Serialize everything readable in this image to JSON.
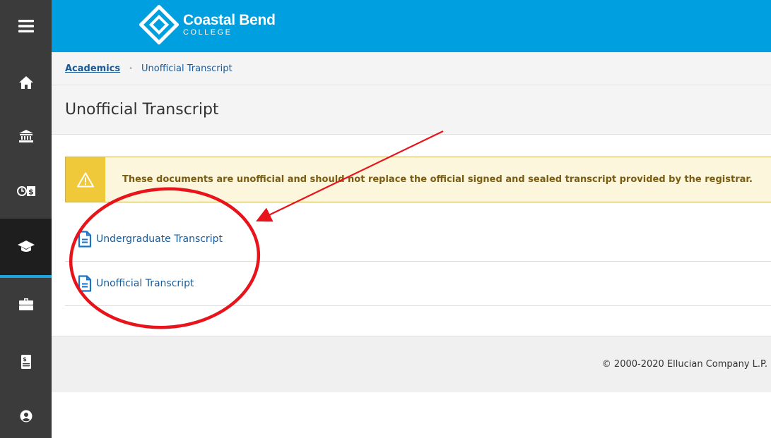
{
  "header": {
    "logo_name": "Coastal Bend",
    "logo_sub": "COLLEGE",
    "color": "#009fe0"
  },
  "rail": {
    "items": [
      {
        "icon": "menu-icon"
      },
      {
        "icon": "home-icon"
      },
      {
        "icon": "bank-icon"
      },
      {
        "icon": "time-money-icon"
      },
      {
        "icon": "graduation-cap-icon",
        "active": true
      },
      {
        "icon": "briefcase-icon"
      },
      {
        "icon": "ledger-icon"
      },
      {
        "icon": "user-circle-icon"
      }
    ],
    "active_color": "#1fa3dd"
  },
  "breadcrumb": {
    "root": "Academics",
    "separator": "•",
    "current": "Unofficial Transcript"
  },
  "page": {
    "title": "Unofficial Transcript"
  },
  "alert": {
    "type": "warning",
    "icon": "warning-icon",
    "text": "These documents are unofficial and should not replace the official signed and sealed transcript provided by the registrar."
  },
  "documents": [
    {
      "label": "Undergraduate Transcript",
      "icon": "document-icon"
    },
    {
      "label": "Unofficial Transcript",
      "icon": "document-icon"
    }
  ],
  "footer": {
    "copyright": "© 2000-2020 Ellucian Company L.P."
  },
  "annotation": {
    "color": "#e8141b",
    "shapes": [
      "arrow",
      "ellipse"
    ]
  }
}
